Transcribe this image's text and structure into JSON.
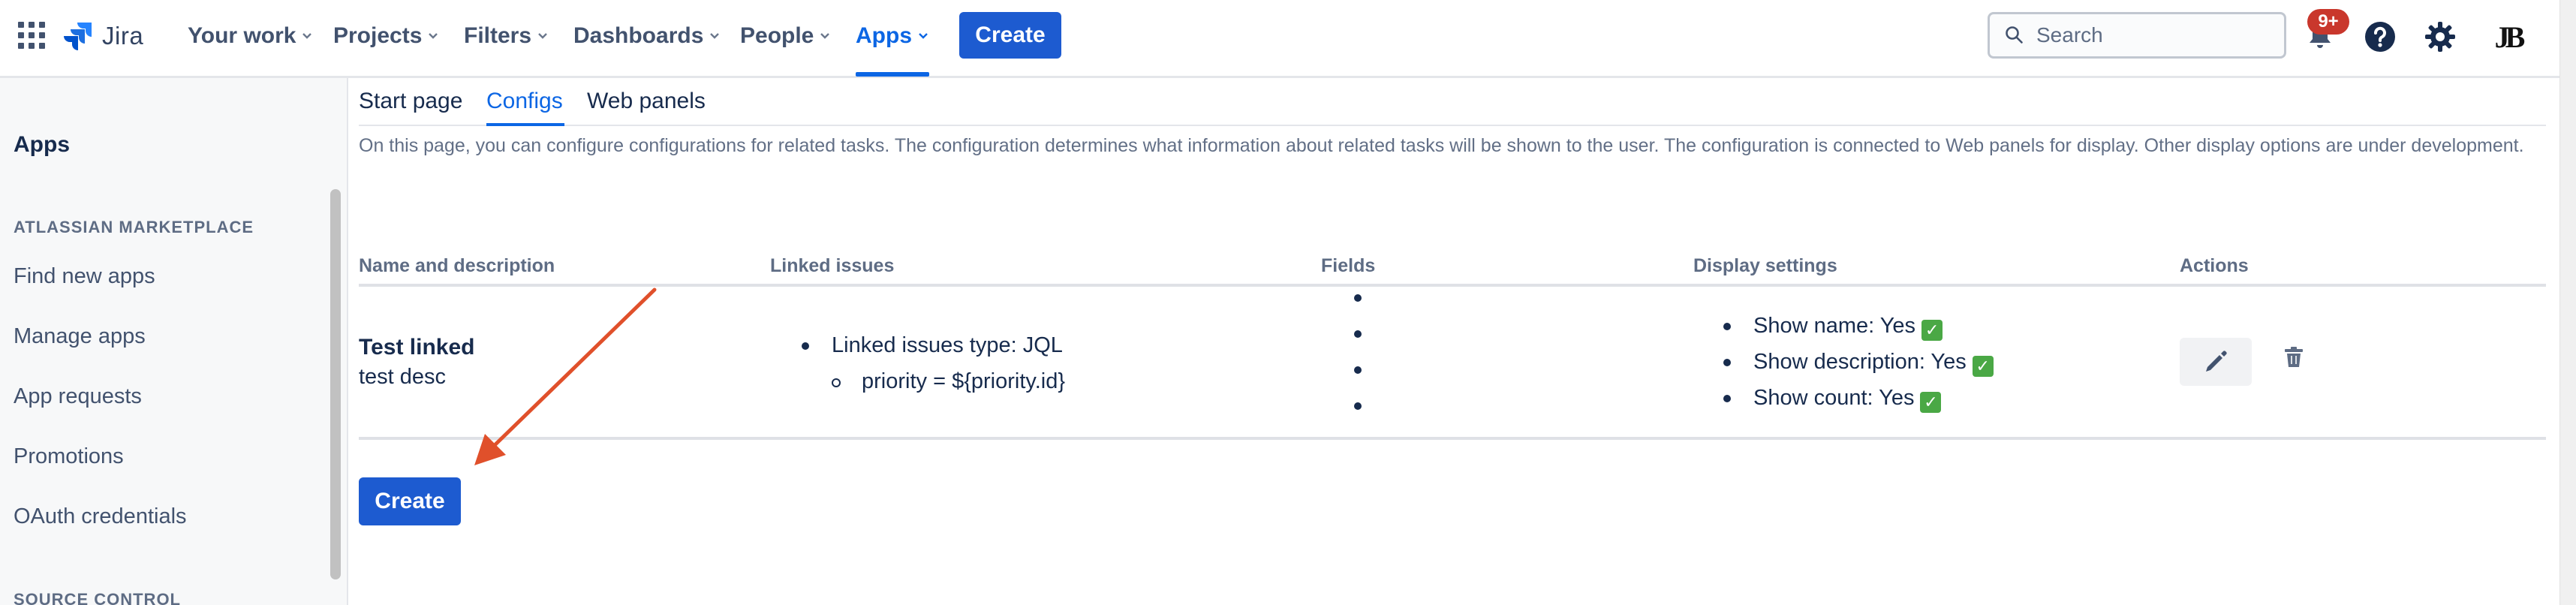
{
  "topnav": {
    "product_name": "Jira",
    "items": [
      {
        "label": "Your work"
      },
      {
        "label": "Projects"
      },
      {
        "label": "Filters"
      },
      {
        "label": "Dashboards"
      },
      {
        "label": "People"
      },
      {
        "label": "Apps",
        "active": true
      }
    ],
    "create_label": "Create",
    "search_placeholder": "Search",
    "notifications_badge": "9+",
    "avatar_initials": "JB"
  },
  "sidebar": {
    "title": "Apps",
    "sections": [
      {
        "heading": "ATLASSIAN MARKETPLACE",
        "items": [
          "Find new apps",
          "Manage apps",
          "App requests",
          "Promotions",
          "OAuth credentials"
        ]
      },
      {
        "heading": "SOURCE CONTROL",
        "items": []
      }
    ]
  },
  "main": {
    "tabs": [
      {
        "label": "Start page"
      },
      {
        "label": "Configs",
        "active": true
      },
      {
        "label": "Web panels"
      }
    ],
    "intro": "On this page, you can configure configurations for related tasks. The configuration determines what information about related tasks will be shown to the user. The configuration is connected to Web panels for display. Other display options are under development.",
    "table": {
      "headers": [
        "Name and description",
        "Linked issues",
        "Fields",
        "Display settings",
        "Actions"
      ],
      "rows": [
        {
          "name": "Test linked",
          "description": "test desc",
          "linked_issues": {
            "type_line": "Linked issues type: JQL",
            "query_line": "priority = ${priority.id}"
          },
          "fields_bullets": 4,
          "display_settings": [
            "Show name: Yes",
            "Show description: Yes",
            "Show count: Yes"
          ]
        }
      ]
    },
    "create_label": "Create"
  },
  "colors": {
    "accent": "#0c66e4",
    "primary_button": "#1d5bd0",
    "badge": "#c9372c",
    "check": "#4aa845",
    "annotation_arrow": "#e0502b"
  }
}
